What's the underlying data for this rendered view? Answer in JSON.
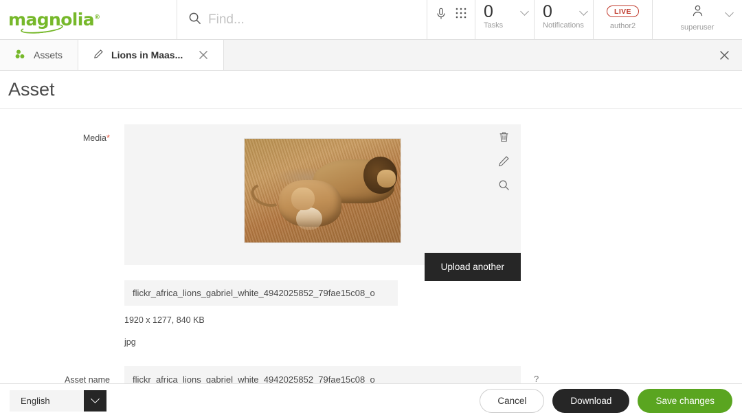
{
  "app": {
    "logo_text": "magnolia",
    "logo_reg": "®"
  },
  "search": {
    "placeholder": "Find...",
    "value": "",
    "icon": "search-icon"
  },
  "topbar": {
    "mic_icon": "microphone-icon",
    "apps_icon": "apps-grid-icon",
    "tasks": {
      "count": "0",
      "label": "Tasks",
      "caret": "chevron-down-icon"
    },
    "notifications": {
      "count": "0",
      "label": "Notifications",
      "caret": "chevron-down-icon"
    },
    "instance": {
      "badge": "LIVE",
      "name": "author2",
      "badge_color": "#c0392b"
    },
    "user": {
      "name": "superuser",
      "icon": "user-avatar-icon",
      "caret": "chevron-down-icon"
    }
  },
  "tabs": [
    {
      "label": "Assets",
      "icon": "assets-clover-icon",
      "active": false
    },
    {
      "label": "Lions in Maas...",
      "icon": "pencil-edit-icon",
      "active": true,
      "close": "close-icon"
    }
  ],
  "tabbar": {
    "close_all": "close-icon"
  },
  "page": {
    "title": "Asset"
  },
  "form": {
    "media": {
      "label": "Media",
      "required_marker": "*",
      "actions": [
        "delete-icon",
        "edit-icon",
        "preview-icon"
      ],
      "upload_button": "Upload another",
      "filename": "flickr_africa_lions_gabriel_white_4942025852_79fae15c08_o",
      "dimensions_size": "1920 x 1277, 840 KB",
      "format": "jpg",
      "image_alt": "Two lions walking in golden savanna grass"
    },
    "asset_name": {
      "label": "Asset name",
      "value": "flickr_africa_lions_gabriel_white_4942025852_79fae15c08_o",
      "help": "?"
    }
  },
  "footer": {
    "language": {
      "value": "English",
      "caret": "chevron-down-icon"
    },
    "cancel": "Cancel",
    "download": "Download",
    "save": "Save changes"
  },
  "colors": {
    "brand_green": "#76b82a",
    "save_green": "#5aa520",
    "dark": "#262626",
    "panel_gray": "#f4f4f4",
    "live_red": "#c0392b",
    "required_red": "#e8604c"
  }
}
